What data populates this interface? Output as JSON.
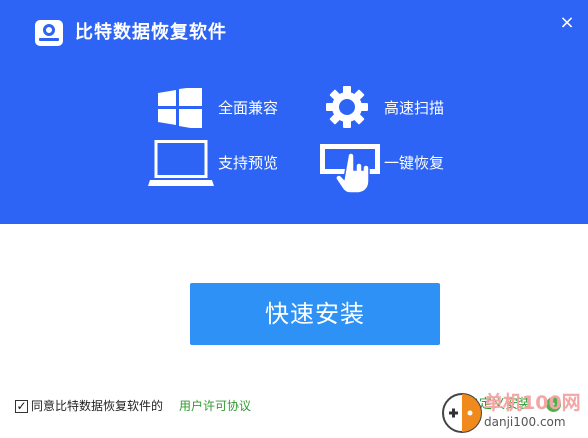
{
  "window": {
    "title": "比特数据恢复软件",
    "close_glyph": "×"
  },
  "features": [
    {
      "label": "全面兼容",
      "icon": "windows-icon"
    },
    {
      "label": "高速扫描",
      "icon": "gear-icon"
    },
    {
      "label": "支持预览",
      "icon": "laptop-icon"
    },
    {
      "label": "一键恢复",
      "icon": "hand-click-icon"
    }
  ],
  "install": {
    "label": "快速安装"
  },
  "agreement": {
    "checked": true,
    "check_glyph": "✓",
    "text": "同意比特数据恢复软件的",
    "link": "用户许可协议"
  },
  "custom_install": {
    "label": "自定义安装",
    "arrow_glyph": "›"
  },
  "watermark": {
    "title": "单机100网",
    "url": "danji100.com"
  },
  "colors": {
    "header_bg": "#2d64f5",
    "install_button": "#2d91f5",
    "link_green": "#2f9a2f"
  }
}
